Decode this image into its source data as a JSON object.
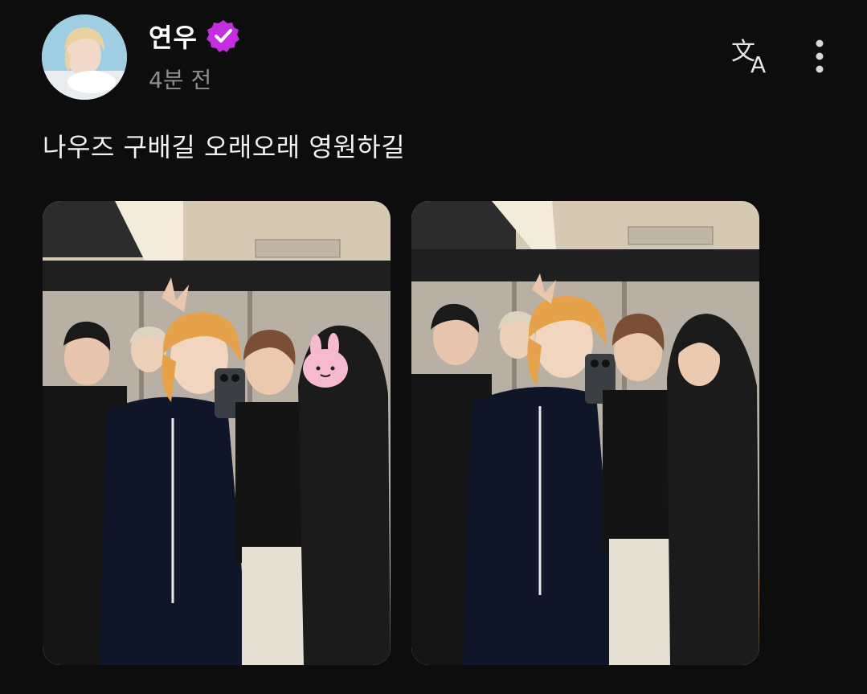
{
  "post": {
    "author": {
      "name": "연우",
      "verified": true,
      "avatar": "profile-photo"
    },
    "timestamp": "4분 전",
    "body_text": "나우즈 구배길 오래오래 영원하길",
    "actions": {
      "translate_icon": "translate-icon",
      "more_icon": "more-vertical-icon"
    },
    "photos": [
      {
        "name": "photo-1",
        "description": "mirror-selfie-group-photo"
      },
      {
        "name": "photo-2",
        "description": "mirror-selfie-group-photo"
      }
    ]
  },
  "colors": {
    "background": "#0d0d0d",
    "verified_badge": "#c42ee0",
    "muted_text": "#8e8e8e",
    "primary_text": "#ffffff"
  }
}
